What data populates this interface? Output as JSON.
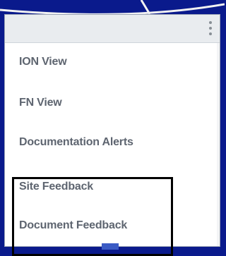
{
  "menu": {
    "more_options_icon": "kebab-vertical-icon",
    "items": [
      {
        "label": "ION View"
      },
      {
        "label": "FN View"
      },
      {
        "label": "Documentation Alerts"
      },
      {
        "label": "Site Feedback"
      },
      {
        "label": "Document Feedback"
      }
    ]
  },
  "colors": {
    "background": "#0a1a8c",
    "panel": "#ffffff",
    "header": "#e9ecef",
    "item_text": "#5e6570",
    "highlight_border": "#000000"
  }
}
